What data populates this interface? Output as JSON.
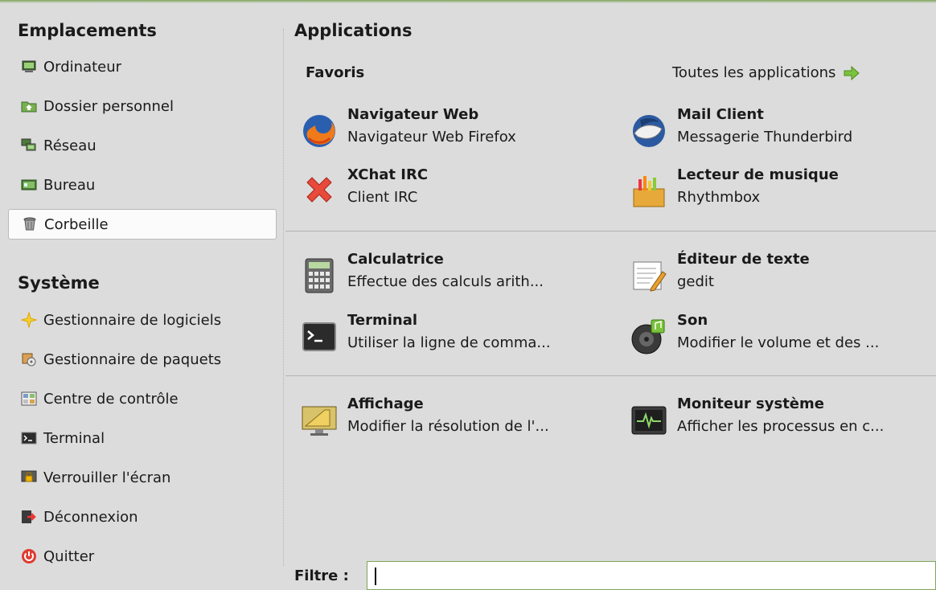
{
  "places": {
    "title": "Emplacements",
    "items": [
      {
        "label": "Ordinateur",
        "icon": "computer-icon"
      },
      {
        "label": "Dossier personnel",
        "icon": "home-folder-icon"
      },
      {
        "label": "Réseau",
        "icon": "network-icon"
      },
      {
        "label": "Bureau",
        "icon": "desktop-icon"
      },
      {
        "label": "Corbeille",
        "icon": "trash-icon",
        "selected": true
      }
    ]
  },
  "system": {
    "title": "Système",
    "items": [
      {
        "label": "Gestionnaire de logiciels",
        "icon": "software-manager-icon"
      },
      {
        "label": "Gestionnaire de paquets",
        "icon": "package-manager-icon"
      },
      {
        "label": "Centre de contrôle",
        "icon": "control-center-icon"
      },
      {
        "label": "Terminal",
        "icon": "terminal-icon"
      },
      {
        "label": "Verrouiller l'écran",
        "icon": "lock-screen-icon"
      },
      {
        "label": "Déconnexion",
        "icon": "logout-icon"
      },
      {
        "label": "Quitter",
        "icon": "power-icon"
      }
    ]
  },
  "applications": {
    "title": "Applications",
    "favorites_label": "Favoris",
    "all_apps_label": "Toutes les applications",
    "all_apps_icon": "green-arrow-right-icon",
    "apps": [
      {
        "name": "Navigateur Web",
        "description": "Navigateur Web Firefox",
        "icon": "firefox-icon"
      },
      {
        "name": "Mail Client",
        "description": "Messagerie Thunderbird",
        "icon": "thunderbird-icon"
      },
      {
        "name": "XChat IRC",
        "description": "Client IRC",
        "icon": "xchat-icon"
      },
      {
        "name": "Lecteur de musique",
        "description": "Rhythmbox",
        "icon": "rhythmbox-icon"
      },
      {
        "name": "Calculatrice",
        "description": "Effectue des calculs arith...",
        "icon": "calculator-icon"
      },
      {
        "name": "Éditeur de texte",
        "description": "gedit",
        "icon": "text-editor-icon"
      },
      {
        "name": "Terminal",
        "description": "Utiliser la ligne de comma...",
        "icon": "terminal-icon"
      },
      {
        "name": "Son",
        "description": "Modifier le volume et des ...",
        "icon": "sound-icon"
      },
      {
        "name": "Affichage",
        "description": "Modifier la résolution de l'...",
        "icon": "display-icon"
      },
      {
        "name": "Moniteur système",
        "description": "Afficher les processus en c...",
        "icon": "system-monitor-icon"
      }
    ]
  },
  "filter": {
    "label": "Filtre :",
    "value": ""
  },
  "colors": {
    "background": "#dcdcdc",
    "accent_green": "#7fa65a",
    "selected_bg": "#fbfbfb"
  }
}
